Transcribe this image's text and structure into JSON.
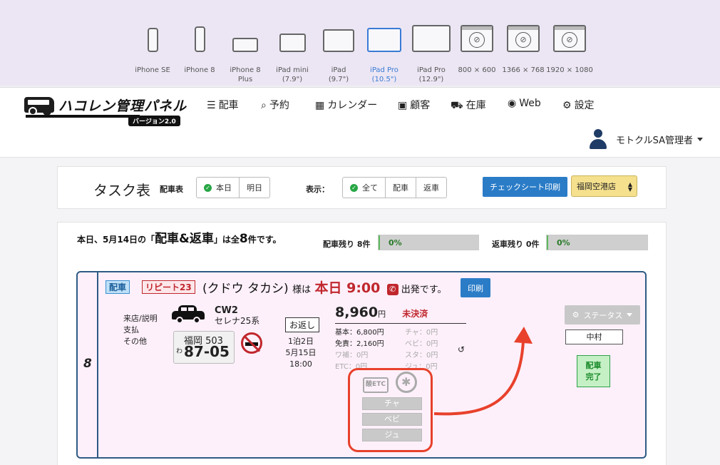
{
  "devices": [
    {
      "label": "iPhone SE",
      "icon": "phone-icon"
    },
    {
      "label": "iPhone 8",
      "icon": "phone-icon"
    },
    {
      "label": "iPhone 8\nPlus",
      "icon": "phone-landscape-icon"
    },
    {
      "label": "iPad mini\n(7.9\")",
      "icon": "tablet-icon"
    },
    {
      "label": "iPad\n(9.7\")",
      "icon": "tablet-icon"
    },
    {
      "label": "iPad Pro\n(10.5\")",
      "icon": "tablet-icon",
      "active": true
    },
    {
      "label": "iPad Pro\n(12.9\")",
      "icon": "tablet-icon"
    },
    {
      "label": "800 × 600",
      "icon": "browser-icon"
    },
    {
      "label": "1366 × 768",
      "icon": "browser-icon"
    },
    {
      "label": "1920 × 1080",
      "icon": "browser-icon"
    }
  ],
  "app": {
    "logo_title": "ハコレン管理パネル",
    "logo_version": "バージョン2.0",
    "nav": [
      {
        "label": "配車",
        "icon": "list-icon"
      },
      {
        "label": "予約",
        "icon": "search-icon"
      },
      {
        "label": "カレンダー",
        "icon": "calendar-icon"
      },
      {
        "label": "顧客",
        "icon": "contact-icon"
      },
      {
        "label": "在庫",
        "icon": "car-icon"
      },
      {
        "label": "Web",
        "icon": "globe-icon"
      },
      {
        "label": "設定",
        "icon": "gear-icon"
      }
    ],
    "user_name": "モトクルSA管理者"
  },
  "taskbar": {
    "title": "タスク表",
    "dispatch_label": "配車表",
    "day_options": [
      "本日",
      "明日"
    ],
    "display_label": "表示：",
    "display_options": [
      "全て",
      "配車",
      "返車"
    ],
    "print_check_label": "チェックシート印刷",
    "store_selected": "福岡空港店"
  },
  "summary": {
    "prefix": "本日、5月14日の「",
    "kind": "配車&返車",
    "mid": "」は全",
    "count": "8",
    "suffix": "件です。",
    "dispatch_remaining_label": "配車残り 8件",
    "dispatch_progress": "0%",
    "return_remaining_label": "返車残り 0件",
    "return_progress": "0%"
  },
  "task": {
    "number": "8",
    "tag_type": "配車",
    "tag_repeat": "リピート23",
    "customer": "(クドウ タカシ)",
    "sama": "様は",
    "when": "本日 9:00",
    "depart": "出発です。",
    "print_label": "印刷",
    "info_labels": [
      "来店/説明",
      "支払",
      "その他"
    ],
    "car_code": "CW2",
    "car_name": "セレナ25系",
    "plate_region": "福岡 503",
    "plate_kana": "わ",
    "plate_number": "87-05",
    "return_tag": "お返し",
    "stay_nights": "1泊2日",
    "return_date": "5月15日",
    "return_time": "18:00",
    "price": "8,960",
    "price_unit": "円",
    "payment_status": "未決済",
    "fees": [
      {
        "left": "基本：6,800円",
        "right": "チャ：0円"
      },
      {
        "left": "免責：2,160円",
        "right": "ベビ：0円"
      },
      {
        "left": "ワ補：0円",
        "right": "スタ：0円"
      },
      {
        "left": "ETC：0円",
        "right": "ジュ：0円"
      }
    ],
    "etc_label": "酸ETC",
    "option_buttons": [
      "チャ",
      "ベビ",
      "ジュ"
    ],
    "status_label": "ステータス",
    "staff_name": "中村",
    "done_label": "配車\n完了"
  }
}
